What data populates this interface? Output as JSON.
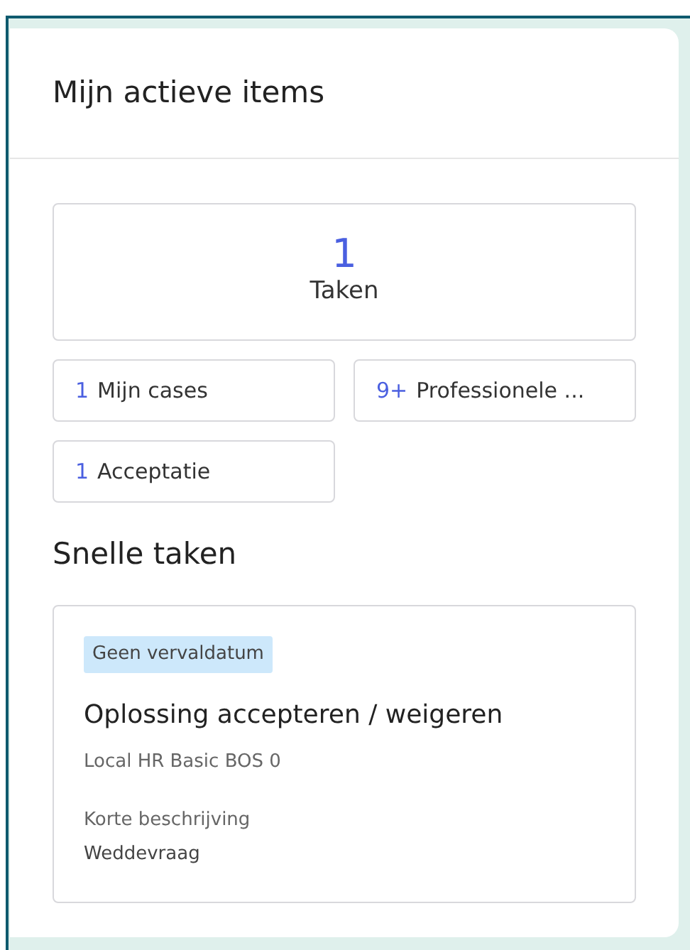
{
  "panel": {
    "title": "Mijn actieve items"
  },
  "main_tile": {
    "count": "1",
    "label": "Taken"
  },
  "tiles": [
    {
      "count": "1",
      "label": "Mijn cases"
    },
    {
      "count": "9+",
      "label": "Professionele ..."
    },
    {
      "count": "1",
      "label": "Acceptatie"
    }
  ],
  "quick_tasks": {
    "title": "Snelle taken",
    "task": {
      "tag": "Geen vervaldatum",
      "title": "Oplossing accepteren / weigeren",
      "subtitle": "Local HR Basic BOS 0",
      "field_label": "Korte beschrijving",
      "field_value": "Weddevraag"
    }
  }
}
